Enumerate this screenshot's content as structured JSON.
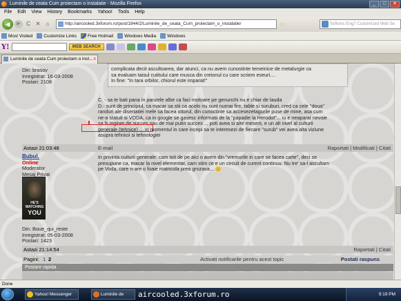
{
  "window": {
    "title": "Luminile de ceata Cum proiectam o instalatie - Mozilla Firefox",
    "minimize": "_",
    "maximize": "□",
    "close": "✕"
  },
  "menu": [
    "File",
    "Edit",
    "View",
    "History",
    "Bookmarks",
    "Yahoo!",
    "Tools",
    "Help"
  ],
  "nav": {
    "back": "◀",
    "forward": "▶",
    "reload": "C",
    "stop": "✕",
    "home": "⌂",
    "url": "http://aircooled.3xforum.ro/post/1844/2/Luminile_de_ceata_Cum_proiectam_o_instalatie/",
    "star": "☆",
    "search_placeholder": "Softonic-Eng7 Customized Web Se"
  },
  "bookmarks": [
    "Most Visited",
    "Customize Links",
    "Free Hotmail",
    "Windows Media",
    "Windows"
  ],
  "yahoo": {
    "logo": "Y!",
    "search_button": "WEB SEARCH"
  },
  "tab": {
    "title": "Luminile de ceata Cum proiectam o inst...",
    "close": "x"
  },
  "post1": {
    "location": "Din: brasov",
    "registered": "Inregistrat: 16-03-2008",
    "posts": "Postari: 2108",
    "quote_lines": [
      "complicata decit ascultoarea, dar atunci, ca nu avem cunostinte temeinice de metalurgie ca",
      "sa evaluam taisul cutitului care musca din creionul cu care scriem eseuri....",
      "In fine: \"In tara orbilor, chiorul este imparat!\""
    ],
    "body_lines": [
      "C. - sa te bati pana in panzele albe ca faci motoare pe genunchi nu e chiar de lauda",
      "D.- sunt de principiul, ca macar sa stii ca acolo nu sunt numai fire, table si suruburi, cred ca cele \"doua\"",
      "randuri ale disertatiei mele sa facea ottorul, din cunoctinte sa accesezetagurile puse de mine, asa cum",
      "ne-a statuit si VODA, ca in google se gasesc informatii de la \"papadie la Herodot\"... iu e neaparat nevoie",
      "sa fii inginer de succes sau de mai putin succes ... poti avea si alte meserii, e un alt nivel al culturii",
      "generale (tehnice) ... in momentul in care incepi sa te interesezi de fiecare \"surub\" vei avea alta viziune",
      "asupra tehnicii si tehnologiei"
    ],
    "time": "Astazi 21:03:48",
    "email": "E-mail",
    "actions": "Raportati | Modificati | Citati"
  },
  "post2": {
    "username": "Bubul.",
    "status": "Online",
    "role": "Moderator",
    "pm": "Mesaj Privat",
    "avatar_line1": "HE'S WATCHING",
    "avatar_line2": "YOU",
    "location": "Din: Boue_qui_reste",
    "registered": "Inregistrat: 05-03-2008",
    "posts": "Postari: 1423",
    "body_lines": [
      "In privinta cuiturii generale: cam toti de pe aici o avem din \"vremurile in care se facea carte\", deci se",
      "presupune ca, macar la nivel elementar, cam stim ce e un circuit de curent continuu. Nu tre' sa-l ascultam",
      "pe Voda, care n-are o foaie matricola prea grozava..."
    ],
    "emoji": "😊",
    "time": "Astazi 21:14:54",
    "actions": "Raportati | Citati"
  },
  "pagination": {
    "label": "Pagini:",
    "page1": "1",
    "page2": "2",
    "notify": "Activati notificarile pentru acest topic",
    "reply": "Postati raspuns"
  },
  "quick_reply": "Postare rapida",
  "status": "Done",
  "taskbar": {
    "btn1": "Yahoo! Messenger",
    "btn2": "Luminile de",
    "overlay": "aircooled.3xforum.ro",
    "clock": "9:19 PM"
  }
}
